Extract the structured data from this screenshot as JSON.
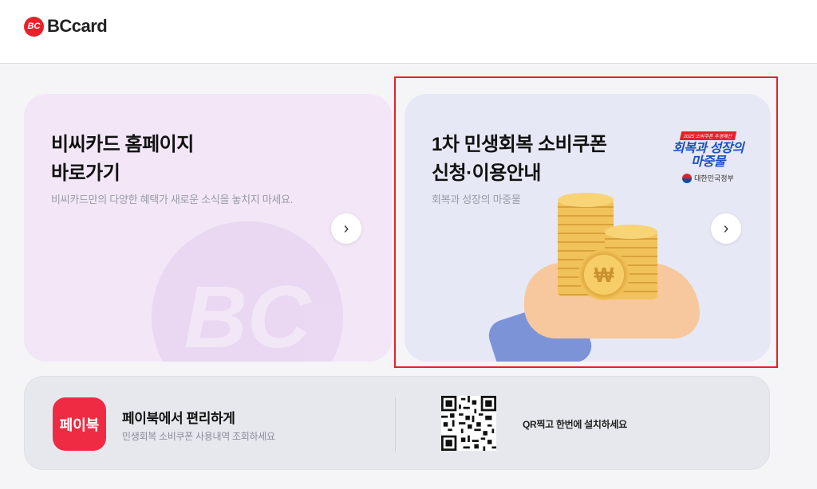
{
  "header": {
    "logo_mark": "BC",
    "logo_text": "BCcard"
  },
  "card_left": {
    "title_line1": "비씨카드 홈페이지",
    "title_line2": "바로가기",
    "subtitle": "비씨카드만의 다양한 혜택가 새로운 소식을 놓치지 마세요.",
    "arrow": "›",
    "watermark": "BC"
  },
  "card_right": {
    "title_line1": "1차 민생회복 소비쿠폰",
    "title_line2": "신청·이용안내",
    "subtitle": "회복과 성장의 마중물",
    "arrow": "›",
    "badge_top": "2025 소비쿠폰 추경예산",
    "badge_line1": "회복과 성장의",
    "badge_line2": "마중물",
    "badge_gov": "대한민국정부",
    "coin_symbol": "₩"
  },
  "paybook": {
    "icon_label": "페이북",
    "title": "페이북에서 편리하게",
    "subtitle": "민생회복 소비쿠폰 사용내역 조회하세요",
    "qr_text": "QR찍고 한번에 설치하세요"
  },
  "colors": {
    "brand_red": "#e8202a",
    "left_card_bg": "#f2e6f7",
    "right_card_bg": "#e6e9f5",
    "paybook_red": "#ef2b43"
  }
}
